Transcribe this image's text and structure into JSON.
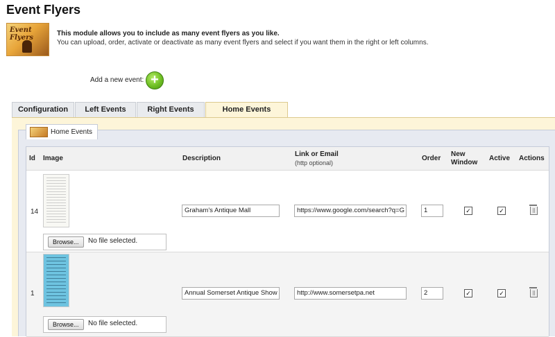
{
  "page": {
    "title": "Event Flyers",
    "intro_bold": "This module allows you to include as many event flyers as you like.",
    "intro_text": "You can upload, order, activate or deactivate as many event flyers and select if you want them in the right or left columns.",
    "hero_image_text": "Event Flyers",
    "add_label": "Add a new event:"
  },
  "tabs": [
    {
      "label": "Configuration",
      "active": false
    },
    {
      "label": "Left Events",
      "active": false
    },
    {
      "label": "Right Events",
      "active": false
    },
    {
      "label": "Home Events",
      "active": true
    }
  ],
  "section": {
    "title": "Home Events"
  },
  "table": {
    "headers": {
      "id": "Id",
      "image": "Image",
      "description": "Description",
      "link": "Link or Email",
      "link_hint": "(http optional)",
      "order": "Order",
      "new_window_1": "New",
      "new_window_2": "Window",
      "active": "Active",
      "actions": "Actions"
    },
    "rows": [
      {
        "id": "14",
        "description": "Graham's Antique Mall",
        "link": "https://www.google.com/search?q=G",
        "order": "1",
        "new_window": true,
        "active": true,
        "browse_label": "Browse...",
        "file_status": "No file selected."
      },
      {
        "id": "1",
        "description": "Annual Somerset Antique Show",
        "link": "http://www.somersetpa.net",
        "order": "2",
        "new_window": true,
        "active": true,
        "browse_label": "Browse...",
        "file_status": "No file selected."
      }
    ]
  },
  "colors": {
    "active_tab": "#fdf5d9",
    "add_button": "#6fbf24",
    "panel": "#e7eaf1"
  }
}
